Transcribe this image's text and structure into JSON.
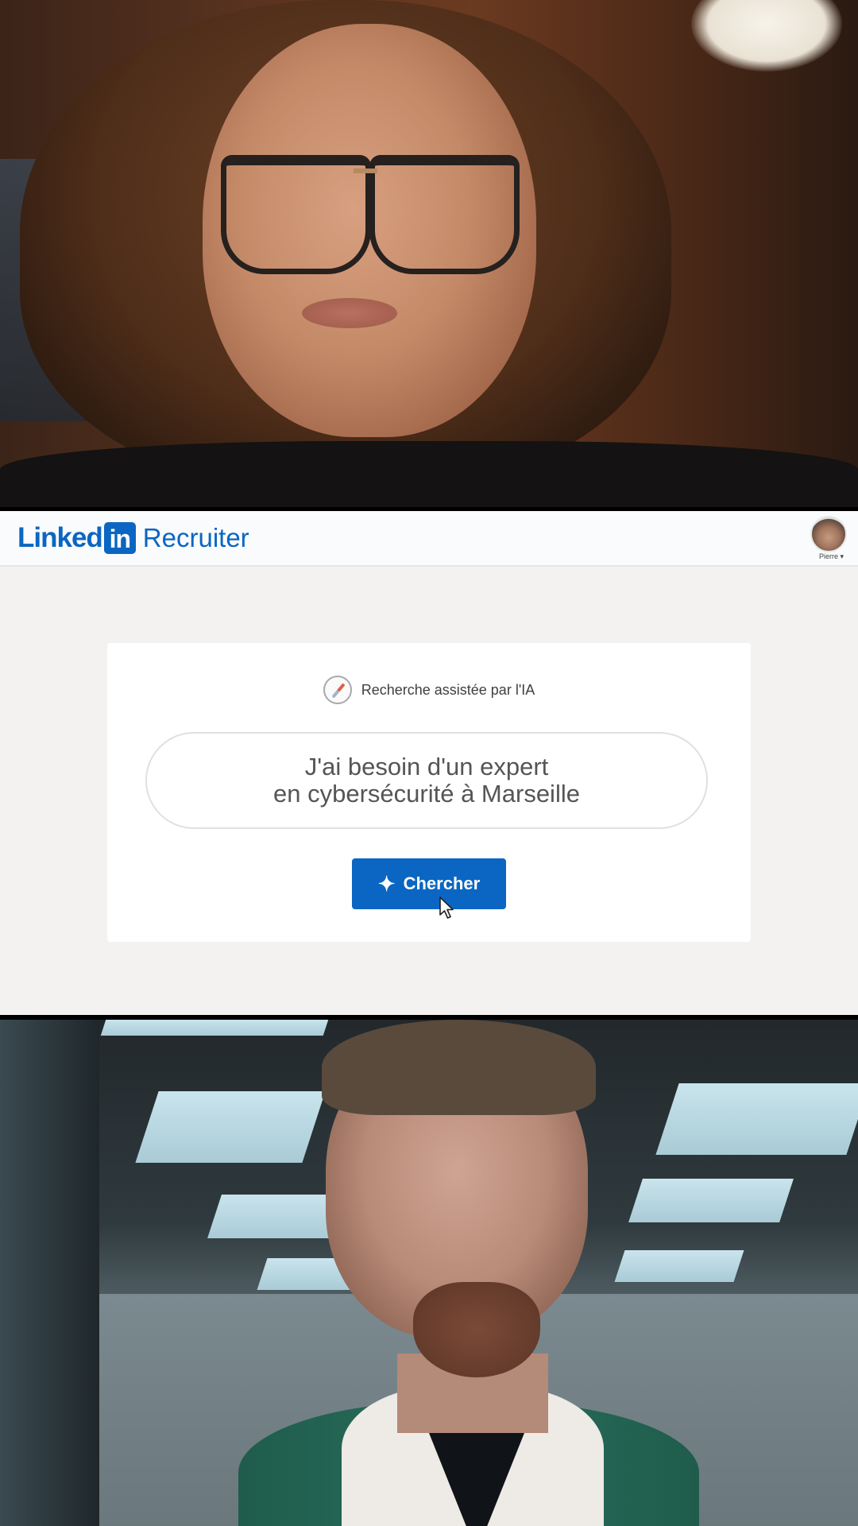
{
  "header": {
    "brand_linked": "Linked",
    "brand_in": "in",
    "brand_product": "Recruiter",
    "user_name": "Pierre ▾"
  },
  "search_card": {
    "ai_label": "Recherche assistée par l'IA",
    "ai_icon": "compass-icon",
    "query_line1": "J'ai besoin d'un expert",
    "query_line2": "en cybersécurité à Marseille",
    "button_icon": "sparkle-icon",
    "button_label": "Chercher"
  },
  "colors": {
    "brand_blue": "#0a66c2",
    "page_bg": "#f3f2f0"
  }
}
